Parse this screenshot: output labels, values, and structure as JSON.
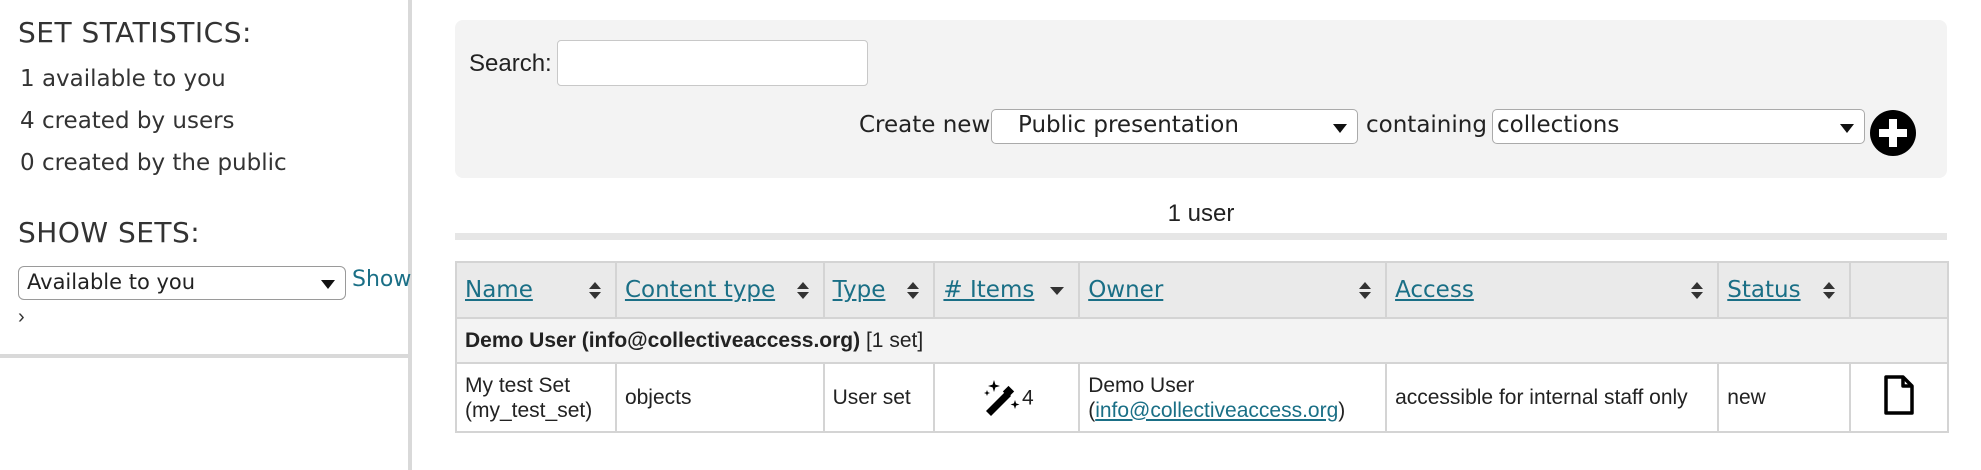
{
  "sidebar": {
    "stats_title": "SET STATISTICS:",
    "stats": [
      "1 available to you",
      "4 created by users",
      "0 created by the public"
    ],
    "show_title": "SHOW SETS:",
    "show_select_value": "Available to you",
    "show_link": "Show",
    "arrow": "›"
  },
  "search": {
    "label": "Search:",
    "value": "",
    "create_label": "Create new",
    "type_value": "Public presentation",
    "containing_label": "containing",
    "contain_value": "collections",
    "add_icon": "plus-circle-icon"
  },
  "user_count": "1 user",
  "table": {
    "columns": [
      "Name",
      "Content type",
      "Type",
      "# Items",
      "Owner",
      "Access",
      "Status",
      ""
    ],
    "group": {
      "owner_label": "Demo User (info@collectiveaccess.org)",
      "count": "[1 set]"
    },
    "rows": [
      {
        "name_line1": "My test Set",
        "name_line2": "(my_test_set)",
        "content_type": "objects",
        "type": "User set",
        "items": "4",
        "owner_name": "Demo User",
        "owner_email_open": "(",
        "owner_email": "info@collectiveaccess.org",
        "owner_email_close": ")",
        "access": "accessible for internal staff only",
        "status": "new",
        "action_icon": "document-icon"
      }
    ]
  },
  "colors": {
    "link": "#1a6f86",
    "header_bg": "#eaeaea",
    "panel_bg": "#f3f3f3"
  }
}
